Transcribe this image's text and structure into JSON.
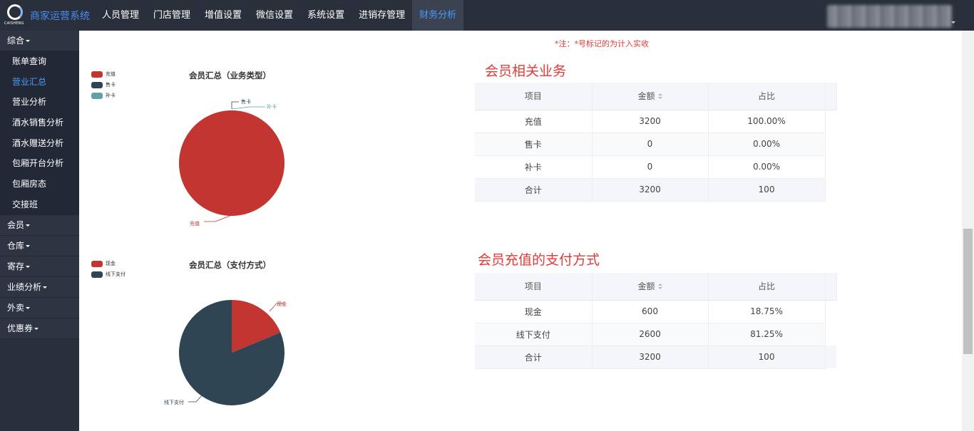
{
  "brand": {
    "logo_text": "CAISHENG",
    "name": "商家运营系统"
  },
  "nav": {
    "items": [
      {
        "label": "人员管理",
        "active": false
      },
      {
        "label": "门店管理",
        "active": false
      },
      {
        "label": "增值设置",
        "active": false
      },
      {
        "label": "微信设置",
        "active": false
      },
      {
        "label": "系统设置",
        "active": false
      },
      {
        "label": "进销存管理",
        "active": false
      },
      {
        "label": "财务分析",
        "active": true
      }
    ]
  },
  "sidebar": {
    "group_overview": "综合",
    "sub_items": [
      {
        "label": "账单查询",
        "active": false
      },
      {
        "label": "营业汇总",
        "active": true
      },
      {
        "label": "营业分析",
        "active": false
      },
      {
        "label": "酒水销售分析",
        "active": false
      },
      {
        "label": "酒水赠送分析",
        "active": false
      },
      {
        "label": "包厢开台分析",
        "active": false
      },
      {
        "label": "包厢房态",
        "active": false
      },
      {
        "label": "交接班",
        "active": false
      }
    ],
    "groups": [
      "会员",
      "仓库",
      "寄存",
      "业绩分析",
      "外卖",
      "优惠券"
    ]
  },
  "note": "*注：*号标记的为计入实收",
  "colors": {
    "red": "#c23531",
    "navy": "#2f4554",
    "teal": "#61a0a8",
    "accent": "#e53935",
    "nav_active": "#4a9cf5"
  },
  "chart_data": [
    {
      "type": "pie",
      "title": "会员汇总（业务类型）",
      "legend": [
        "充值",
        "售卡",
        "补卡"
      ],
      "legend_placement": "top-left",
      "slices": [
        {
          "label": "充值",
          "value": 3200,
          "color": "#c23531"
        },
        {
          "label": "售卡",
          "value": 0,
          "color": "#2f4554"
        },
        {
          "label": "补卡",
          "value": 0,
          "color": "#61a0a8"
        }
      ]
    },
    {
      "type": "pie",
      "title": "会员汇总（支付方式）",
      "legend": [
        "现金",
        "线下支付"
      ],
      "legend_placement": "top-left",
      "slices": [
        {
          "label": "现金",
          "value": 600,
          "color": "#c23531"
        },
        {
          "label": "线下支付",
          "value": 2600,
          "color": "#2f4554"
        }
      ]
    }
  ],
  "section1": {
    "heading": "会员相关业务",
    "headers": [
      "项目",
      "金额",
      "占比"
    ],
    "rows": [
      [
        "充值",
        "3200",
        "100.00%"
      ],
      [
        "售卡",
        "0",
        "0.00%"
      ],
      [
        "补卡",
        "0",
        "0.00%"
      ],
      [
        "合计",
        "3200",
        "100"
      ]
    ]
  },
  "section2": {
    "heading": "会员充值的支付方式",
    "headers": [
      "项目",
      "金额",
      "占比"
    ],
    "rows": [
      [
        "现金",
        "600",
        "18.75%"
      ],
      [
        "线下支付",
        "2600",
        "81.25%"
      ],
      [
        "合计",
        "3200",
        "100"
      ]
    ]
  }
}
